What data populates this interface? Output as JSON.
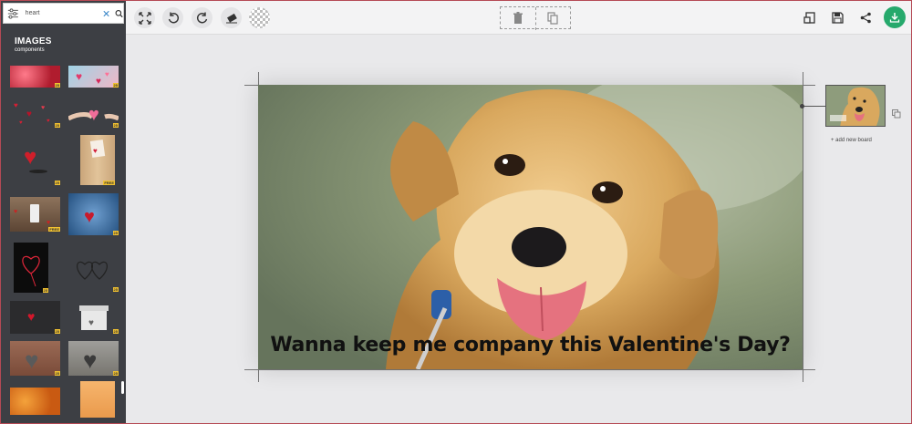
{
  "search": {
    "value": "heart",
    "placeholder": ""
  },
  "sidebar": {
    "title": "IMAGES",
    "subtitle": "components",
    "thumbs": [
      {
        "name": "red-hearts-bokeh",
        "badge": "25",
        "bg": "#c2313f"
      },
      {
        "name": "pink-hearts-blue",
        "badge": "25",
        "bg": "#e8a4b4"
      },
      {
        "name": "scattered-red-hearts",
        "badge": "25",
        "bg": "#3d3f44"
      },
      {
        "name": "hand-pink-heart",
        "badge": "25",
        "bg": "#3d3f44"
      },
      {
        "name": "red-bow-heart",
        "badge": "25",
        "bg": "#3d3f44"
      },
      {
        "name": "wooden-card-heart",
        "badge": "FREE",
        "bg": "#d9b88c"
      },
      {
        "name": "phone-on-wood",
        "badge": "FREE",
        "bg": "#7b6450"
      },
      {
        "name": "blue-heart-ornament",
        "badge": "25",
        "bg": "#3d6fa6"
      },
      {
        "name": "neon-heart-dark",
        "badge": "25",
        "bg": "#111111"
      },
      {
        "name": "outline-hearts",
        "badge": "25",
        "bg": "#3d3f44"
      },
      {
        "name": "small-red-heart",
        "badge": "25",
        "bg": "#2e2e30"
      },
      {
        "name": "gift-box-heart",
        "badge": "25",
        "bg": "#3d3f44"
      },
      {
        "name": "wood-heart-cutout",
        "badge": "25",
        "bg": "#8c5b47"
      },
      {
        "name": "gray-wood-heart",
        "badge": "25",
        "bg": "#8b8a86"
      },
      {
        "name": "orange-flowers",
        "badge": "",
        "bg": "#e0711f"
      },
      {
        "name": "peach-paper",
        "badge": "",
        "bg": "#f0a65a"
      }
    ]
  },
  "canvas": {
    "caption": "Wanna keep me company this Valentine's Day?",
    "add_board_label": "+ add new board"
  },
  "colors": {
    "accent": "#26a96c",
    "frame": "#b54a55"
  }
}
